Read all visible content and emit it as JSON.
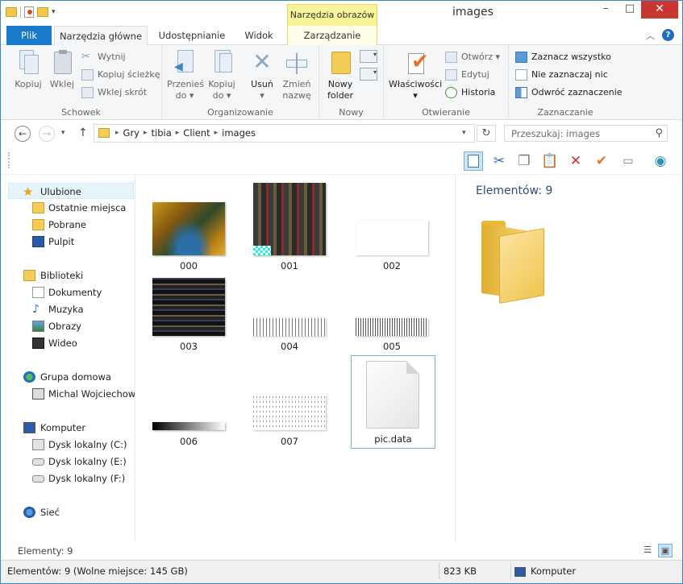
{
  "window": {
    "title": "images",
    "contextual_tab_header": "Narzędzia obrazów"
  },
  "tabs": {
    "file": "Plik",
    "home": "Narzędzia główne",
    "share": "Udostępnianie",
    "view": "Widok",
    "manage": "Zarządzanie"
  },
  "ribbon": {
    "clipboard": {
      "label": "Schowek",
      "copy": "Kopiuj",
      "paste": "Wklej",
      "cut": "Wytnij",
      "copy_path": "Kopiuj ścieżkę",
      "paste_shortcut": "Wklej skrót"
    },
    "organize": {
      "label": "Organizowanie",
      "move_to": "Przenieś",
      "move_to2": "do",
      "copy_to": "Kopiuj",
      "copy_to2": "do",
      "delete": "Usuń",
      "rename": "Zmień",
      "rename2": "nazwę"
    },
    "new": {
      "label": "Nowy",
      "new_folder": "Nowy",
      "new_folder2": "folder"
    },
    "open": {
      "label": "Otwieranie",
      "properties": "Właściwości",
      "open": "Otwórz",
      "edit": "Edytuj",
      "history": "Historia"
    },
    "select": {
      "label": "Zaznaczanie",
      "select_all": "Zaznacz wszystko",
      "select_none": "Nie zaznaczaj nic",
      "invert": "Odwróć zaznaczenie"
    }
  },
  "address": {
    "crumbs": [
      "Gry",
      "tibia",
      "Client",
      "images"
    ]
  },
  "search": {
    "placeholder": "Przeszukaj: images"
  },
  "nav": {
    "favorites": "Ulubione",
    "recent": "Ostatnie miejsca",
    "downloads": "Pobrane",
    "desktop": "Pulpit",
    "libraries": "Biblioteki",
    "documents": "Dokumenty",
    "music": "Muzyka",
    "pictures": "Obrazy",
    "videos": "Wideo",
    "homegroup": "Grupa domowa",
    "user": "Michal Wojciechowski",
    "computer": "Komputer",
    "disk_c": "Dysk lokalny (C:)",
    "disk_e": "Dysk lokalny (E:)",
    "disk_f": "Dysk lokalny (F:)",
    "network": "Sieć"
  },
  "files": [
    "000",
    "001",
    "002",
    "003",
    "004",
    "005",
    "006",
    "007",
    "pic.data"
  ],
  "details": {
    "title": "Elementów: 9"
  },
  "status": {
    "items": "Elementy: 9",
    "bottom_left": "Elementów: 9 (Wolne miejsce: 145 GB)",
    "size": "823 KB",
    "location": "Komputer"
  }
}
